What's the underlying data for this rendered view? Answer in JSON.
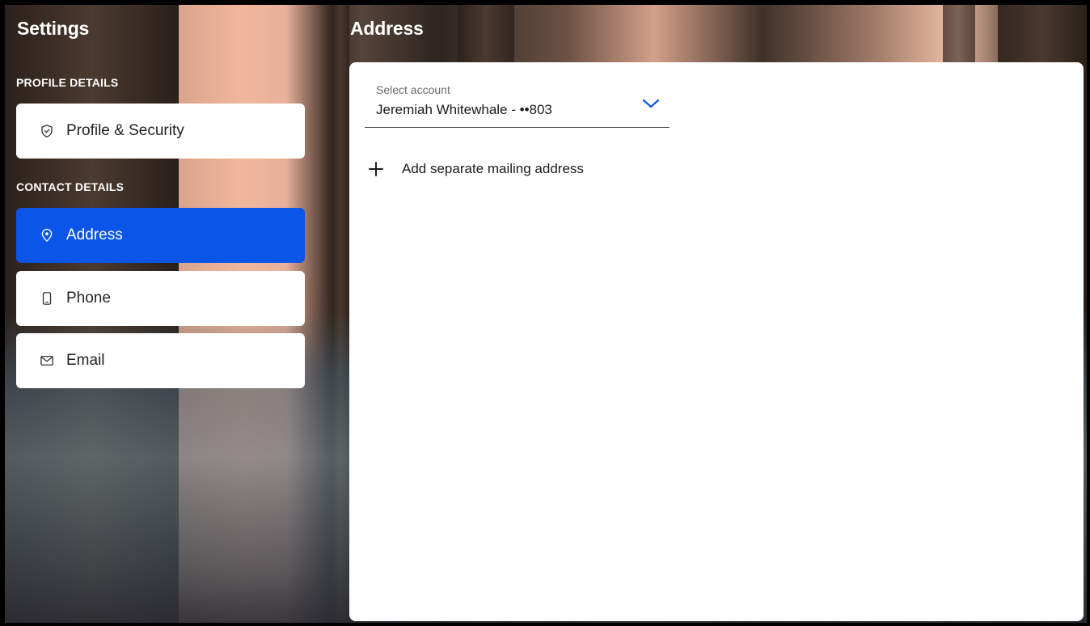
{
  "sidebar": {
    "title": "Settings",
    "sections": [
      {
        "label": "PROFILE DETAILS",
        "items": [
          {
            "label": "Profile & Security",
            "icon": "shield-check-icon"
          }
        ]
      },
      {
        "label": "CONTACT DETAILS",
        "items": [
          {
            "label": "Address",
            "icon": "map-pin-icon",
            "active": true
          },
          {
            "label": "Phone",
            "icon": "mobile-phone-icon"
          },
          {
            "label": "Email",
            "icon": "envelope-icon"
          }
        ]
      }
    ]
  },
  "main": {
    "title": "Address",
    "account_select": {
      "label": "Select account",
      "value": "Jeremiah Whitewhale - ••803",
      "icon": "chevron-down-icon"
    },
    "add_mailing": {
      "label": "Add separate mailing address",
      "icon": "plus-icon"
    }
  },
  "colors": {
    "accent": "#0b55e8",
    "card_bg": "#ffffff",
    "text": "#1b1b1b",
    "muted": "#6b6b6b"
  }
}
